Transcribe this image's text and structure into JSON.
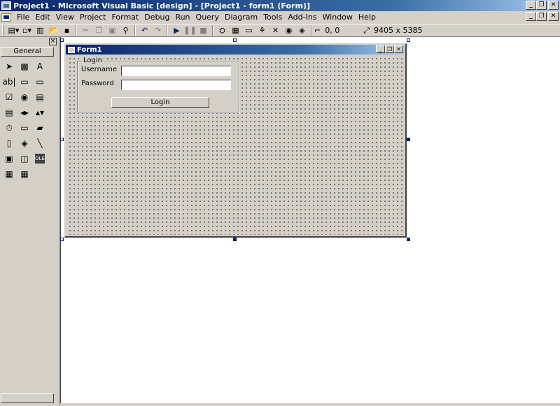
{
  "window": {
    "title": "Project1 - Microsoft Visual Basic [design] - [Project1 - form1 (Form)]",
    "controls": [
      "_",
      "❐",
      "✕"
    ]
  },
  "menubar": {
    "items": [
      "File",
      "Edit",
      "View",
      "Project",
      "Format",
      "Debug",
      "Run",
      "Query",
      "Diagram",
      "Tools",
      "Add-Ins",
      "Window",
      "Help"
    ],
    "mdi_controls": [
      "_",
      "❐",
      "✕"
    ]
  },
  "toolbar": {
    "position": "0, 0",
    "size": "9405 x 5385"
  },
  "toolbox": {
    "close": "×",
    "tab": "General",
    "tools": [
      {
        "name": "pointer-icon",
        "glyph": "➤"
      },
      {
        "name": "picturebox-icon",
        "glyph": "▩"
      },
      {
        "name": "label-icon",
        "glyph": "A"
      },
      {
        "name": "textbox-icon",
        "glyph": "ab|"
      },
      {
        "name": "frame-icon",
        "glyph": "▭"
      },
      {
        "name": "commandbutton-icon",
        "glyph": "▭"
      },
      {
        "name": "checkbox-icon",
        "glyph": "☑"
      },
      {
        "name": "optionbutton-icon",
        "glyph": "◉"
      },
      {
        "name": "combobox-icon",
        "glyph": "▤"
      },
      {
        "name": "listbox-icon",
        "glyph": "▤"
      },
      {
        "name": "hscrollbar-icon",
        "glyph": "◂▸"
      },
      {
        "name": "vscrollbar-icon",
        "glyph": "▴▾"
      },
      {
        "name": "timer-icon",
        "glyph": "⏱"
      },
      {
        "name": "drivelistbox-icon",
        "glyph": "▭"
      },
      {
        "name": "dirlistbox-icon",
        "glyph": "▰"
      },
      {
        "name": "filelistbox-icon",
        "glyph": "▯"
      },
      {
        "name": "shape-icon",
        "glyph": "◈"
      },
      {
        "name": "line-icon",
        "glyph": "╲"
      },
      {
        "name": "image-icon",
        "glyph": "▣"
      },
      {
        "name": "data-icon",
        "glyph": "◫"
      },
      {
        "name": "ole-icon",
        "glyph": "OLE"
      },
      {
        "name": "adodc-icon",
        "glyph": "▦"
      },
      {
        "name": "datagrid-icon",
        "glyph": "▦"
      }
    ]
  },
  "form": {
    "title": "Form1",
    "controls": [
      "_",
      "❐",
      "✕"
    ],
    "frame_caption": "Login",
    "username_label": "Username",
    "password_label": "Password",
    "login_button": "Login"
  }
}
